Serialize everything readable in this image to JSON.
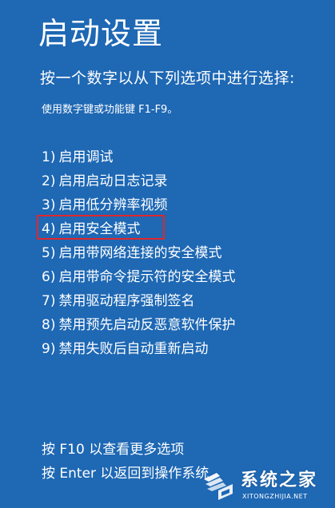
{
  "title": "启动设置",
  "prompt": "按一个数字以从下列选项中进行选择:",
  "hint": "使用数字键或功能键 F1-F9。",
  "options": [
    {
      "num": "1)",
      "label": "启用调试"
    },
    {
      "num": "2)",
      "label": "启用启动日志记录"
    },
    {
      "num": "3)",
      "label": "启用低分辨率视频"
    },
    {
      "num": "4)",
      "label": "启用安全模式",
      "highlighted": true
    },
    {
      "num": "5)",
      "label": "启用带网络连接的安全模式"
    },
    {
      "num": "6)",
      "label": "启用带命令提示符的安全模式"
    },
    {
      "num": "7)",
      "label": "禁用驱动程序强制签名"
    },
    {
      "num": "8)",
      "label": "禁用预先启动反恶意软件保护"
    },
    {
      "num": "9)",
      "label": "禁用失败后自动重新启动"
    }
  ],
  "footer": {
    "more_options": "按 F10 以查看更多选项",
    "return": "按 Enter 以返回到操作系统"
  },
  "watermark": {
    "name": "系统之家",
    "url": "XITONGZHIJIA.NET"
  },
  "colors": {
    "background": "#1e68b4",
    "text": "#ffffff",
    "highlight_border": "#e0262c"
  }
}
